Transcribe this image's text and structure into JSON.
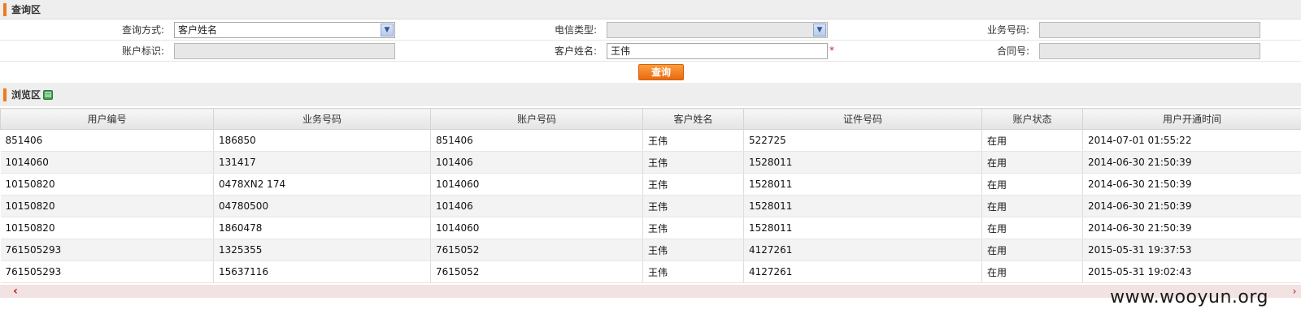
{
  "query_section": {
    "title": "查询区"
  },
  "form": {
    "row1": {
      "query_mode_label": "查询方式:",
      "query_mode_value": "客户姓名",
      "telecom_type_label": "电信类型:",
      "telecom_type_value": "",
      "service_number_label": "业务号码:",
      "service_number_value": ""
    },
    "row2": {
      "account_id_label": "账户标识:",
      "account_id_value": "",
      "customer_name_label": "客户姓名:",
      "customer_name_value": "王伟",
      "required_mark": "*",
      "contract_number_label": "合同号:",
      "contract_number_value": ""
    },
    "search_button": "查询"
  },
  "browse_section": {
    "title": "浏览区",
    "export_icon": "excel-export-icon"
  },
  "table": {
    "columns": [
      "用户编号",
      "业务号码",
      "账户号码",
      "客户姓名",
      "证件号码",
      "账户状态",
      "用户开通时间"
    ],
    "rows": [
      [
        "851406",
        "186850",
        "851406",
        "王伟",
        "522725",
        "在用",
        "2014-07-01 01:55:22"
      ],
      [
        "1014060",
        "131417",
        "101406",
        "王伟",
        "1528011",
        "在用",
        "2014-06-30 21:50:39"
      ],
      [
        "10150820",
        "0478XN2        174",
        "1014060",
        "王伟",
        "1528011",
        "在用",
        "2014-06-30 21:50:39"
      ],
      [
        "10150820",
        "04780500",
        "101406",
        "王伟",
        "1528011",
        "在用",
        "2014-06-30 21:50:39"
      ],
      [
        "10150820",
        "1860478",
        "1014060",
        "王伟",
        "1528011",
        "在用",
        "2014-06-30 21:50:39"
      ],
      [
        "761505293",
        "1325355",
        "7615052",
        "王伟",
        "4127261",
        "在用",
        "2015-05-31 19:37:53"
      ],
      [
        "761505293",
        "15637116",
        "7615052",
        "王伟",
        "4127261",
        "在用",
        "2015-05-31 19:02:43"
      ]
    ]
  },
  "scrollbar": {
    "left_arrow": "‹",
    "right_arrow": "›"
  },
  "watermark": "www.wooyun.org",
  "colors": {
    "accent": "#f07a1b",
    "button": "#ea6a10",
    "required": "#e02020"
  }
}
